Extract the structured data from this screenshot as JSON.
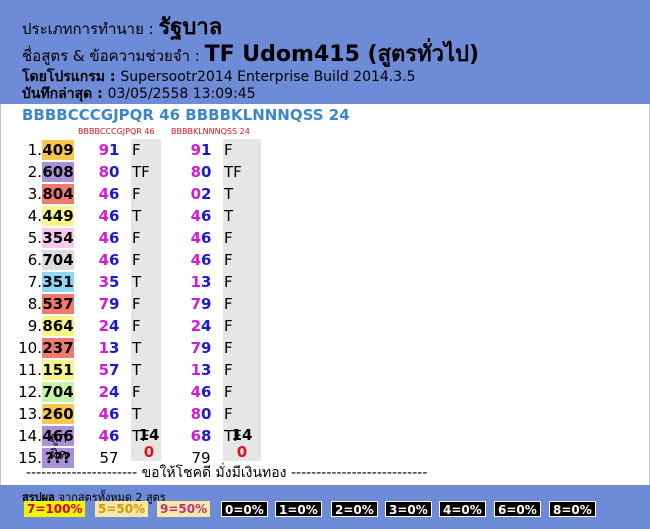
{
  "header": {
    "type_label": "ประเภทการทำนาย : ",
    "type_value": "รัฐบาล",
    "formula_label": "ชื่อสูตร & ข้อความช่วยจำ : ",
    "formula_value": "TF Udom415 (สูตรทั่วไป)",
    "program_label": "โดยโปรแกรม : ",
    "program_value": "Supersootr2014 Enterprise Build 2014.3.5",
    "saved_label": "บันทึกล่าสุด : ",
    "saved_value": "03/05/2558 13:09:45"
  },
  "formulas": {
    "formula1": "BBBBCCCGJPQR 46",
    "formula2": "BBBBKLNNNQSS 24",
    "col1_label": "BBBBCCCGJPQR 46",
    "col2_label": "BBBBKLNNNQSS 24"
  },
  "rows": [
    {
      "idx": "1.",
      "result": "409",
      "bg": "#f5c84e",
      "a1": "9",
      "a2": "1",
      "am": "F",
      "b1": "9",
      "b2": "1",
      "bm": "F"
    },
    {
      "idx": "2.",
      "result": "608",
      "bg": "#a891d6",
      "a1": "8",
      "a2": "0",
      "am": "TF",
      "b1": "8",
      "b2": "0",
      "bm": "TF"
    },
    {
      "idx": "3.",
      "result": "804",
      "bg": "#f07a6e",
      "a1": "4",
      "a2": "6",
      "am": "F",
      "b1": "0",
      "b2": "2",
      "bm": "T"
    },
    {
      "idx": "4.",
      "result": "449",
      "bg": "#f7f58a",
      "a1": "4",
      "a2": "6",
      "am": "T",
      "b1": "4",
      "b2": "6",
      "bm": "T"
    },
    {
      "idx": "5.",
      "result": "354",
      "bg": "#f7c8ec",
      "a1": "4",
      "a2": "6",
      "am": "F",
      "b1": "4",
      "b2": "6",
      "bm": "F"
    },
    {
      "idx": "6.",
      "result": "704",
      "bg": "#dcdcdc",
      "a1": "4",
      "a2": "6",
      "am": "F",
      "b1": "4",
      "b2": "6",
      "bm": "F"
    },
    {
      "idx": "7.",
      "result": "351",
      "bg": "#8ed6f5",
      "a1": "3",
      "a2": "5",
      "am": "T",
      "b1": "1",
      "b2": "3",
      "bm": "F"
    },
    {
      "idx": "8.",
      "result": "537",
      "bg": "#f07a6e",
      "a1": "7",
      "a2": "9",
      "am": "F",
      "b1": "7",
      "b2": "9",
      "bm": "F"
    },
    {
      "idx": "9.",
      "result": "864",
      "bg": "#f7f58a",
      "a1": "2",
      "a2": "4",
      "am": "F",
      "b1": "2",
      "b2": "4",
      "bm": "F"
    },
    {
      "idx": "10.",
      "result": "237",
      "bg": "#f07a6e",
      "a1": "1",
      "a2": "3",
      "am": "T",
      "b1": "7",
      "b2": "9",
      "bm": "F"
    },
    {
      "idx": "11.",
      "result": "151",
      "bg": "#f7f58a",
      "a1": "5",
      "a2": "7",
      "am": "T",
      "b1": "1",
      "b2": "3",
      "bm": "F"
    },
    {
      "idx": "12.",
      "result": "704",
      "bg": "#c6f5a6",
      "a1": "2",
      "a2": "4",
      "am": "F",
      "b1": "4",
      "b2": "6",
      "bm": "F"
    },
    {
      "idx": "13.",
      "result": "260",
      "bg": "#f5c84e",
      "a1": "4",
      "a2": "6",
      "am": "T",
      "b1": "8",
      "b2": "0",
      "bm": "F"
    },
    {
      "idx": "14.",
      "result": "466",
      "bg": "#a891d6",
      "a1": "4",
      "a2": "6",
      "am": "TF",
      "b1": "6",
      "b2": "8",
      "bm": "TF"
    },
    {
      "idx": "15.",
      "result": "???",
      "bg": "#a891d6",
      "a1": "5",
      "a2": "7",
      "am": "",
      "b1": "7",
      "b2": "9",
      "bm": ""
    }
  ],
  "summary": {
    "correct_label": "ถูก",
    "wrong_label": "ผิด",
    "col1_correct": "14",
    "col1_wrong": "0",
    "col2_correct": "14",
    "col2_wrong": "0"
  },
  "divider_text": "---------------------- ขอให้โชคดี มั่งมีเงินทอง ---------------------------",
  "footer": {
    "title": "สรุปผล",
    "subtitle": "จากสูตรทั้งหมด 2 สูตร",
    "badges": [
      {
        "text": "7=100%",
        "bg": "#f5f500",
        "color": "#d40000"
      },
      {
        "text": "5=50%",
        "bg": "#f7e7a8",
        "color": "#d49a00"
      },
      {
        "text": "9=50%",
        "bg": "#f7e7a8",
        "color": "#c0307a"
      },
      {
        "text": "0=0%",
        "bg": "#000000",
        "color": "#ffffff"
      },
      {
        "text": "1=0%",
        "bg": "#000000",
        "color": "#ffffff"
      },
      {
        "text": "2=0%",
        "bg": "#000000",
        "color": "#ffffff"
      },
      {
        "text": "3=0%",
        "bg": "#000000",
        "color": "#ffffff"
      },
      {
        "text": "4=0%",
        "bg": "#000000",
        "color": "#ffffff"
      },
      {
        "text": "6=0%",
        "bg": "#000000",
        "color": "#ffffff"
      },
      {
        "text": "8=0%",
        "bg": "#000000",
        "color": "#ffffff"
      }
    ]
  },
  "colors": {
    "header_bg": "#6d8bd6",
    "digit_magenta": "#d41ad4",
    "digit_blue": "#1a1ad4",
    "wrong_red": "#e0141c"
  }
}
